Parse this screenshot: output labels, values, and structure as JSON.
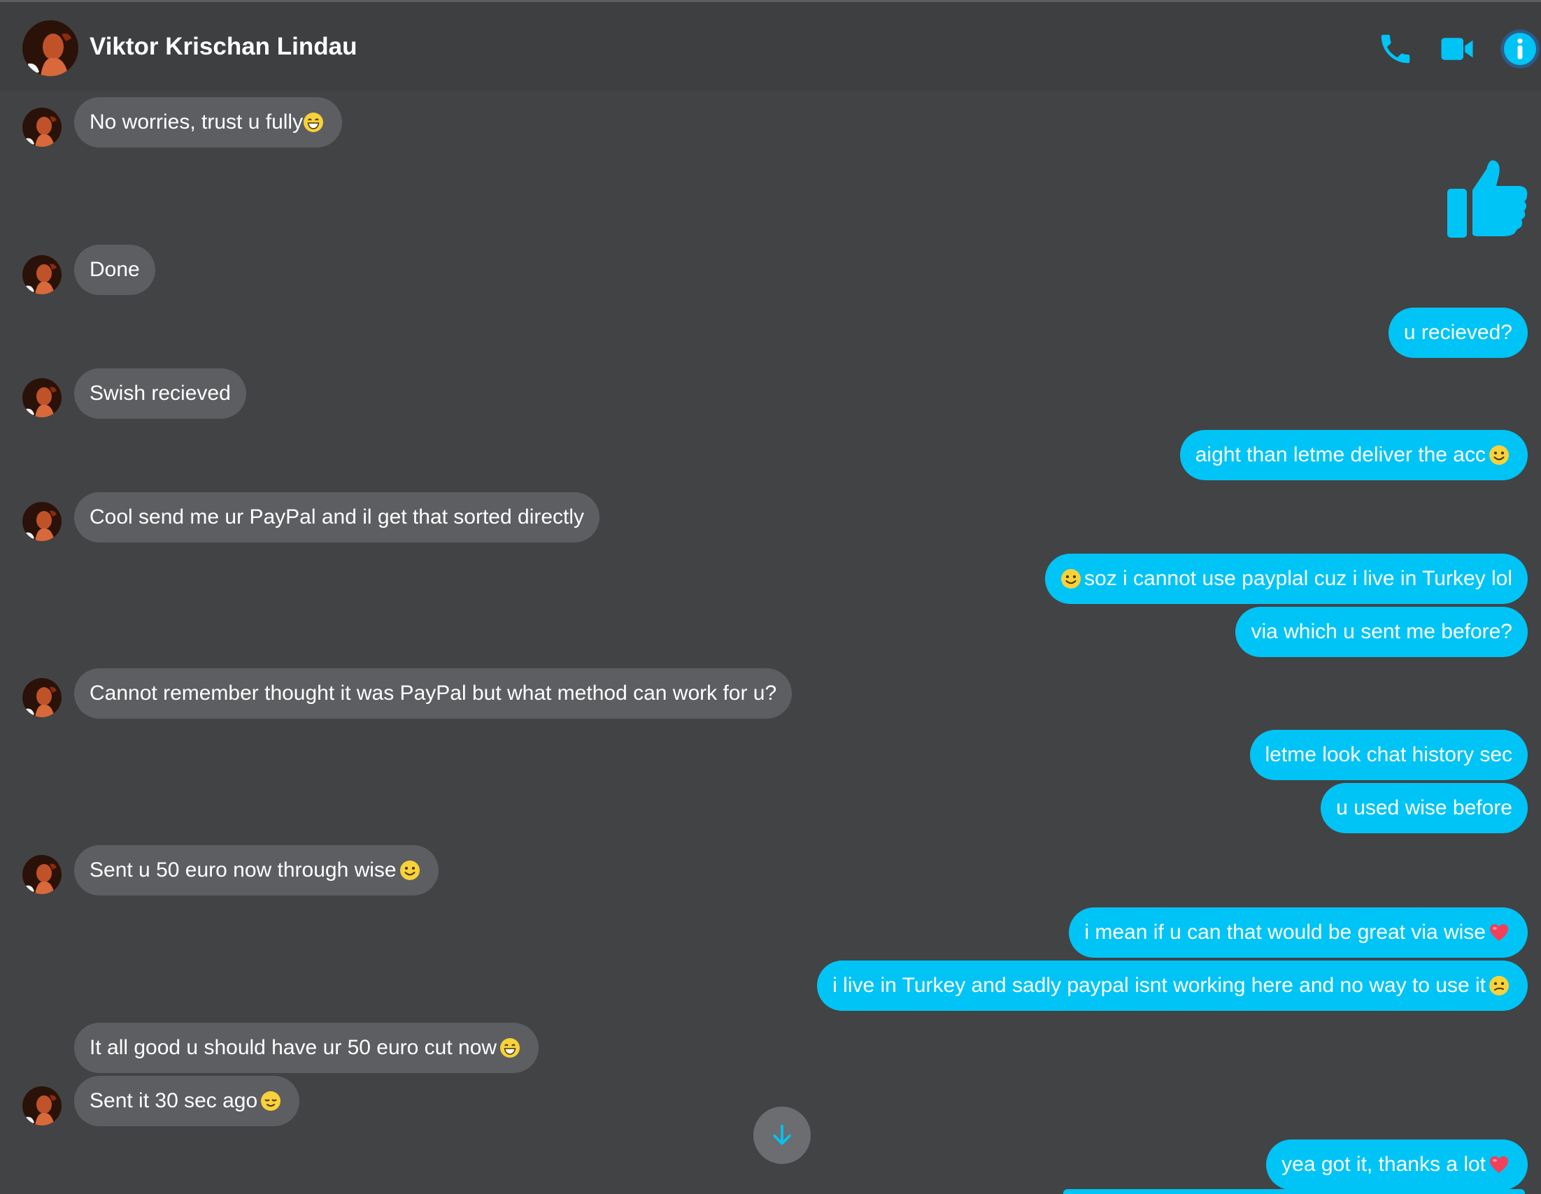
{
  "header": {
    "contact_name": "Viktor Krischan Lindau",
    "icons": [
      "phone-icon",
      "video-camera-icon",
      "info-icon"
    ]
  },
  "colors": {
    "background": "#424345",
    "incoming_bubble": "#5d5e61",
    "outgoing_bubble": "#00c4f5",
    "accent": "#00c4f5"
  },
  "messages": {
    "m1": "No worries,  trust u fully",
    "m2": "Done",
    "m3": "u recieved?",
    "m4": "Swish recieved",
    "m5": "aight than letme deliver the acc",
    "m6": "Cool send me ur PayPal and il get that sorted directly",
    "m7": "soz i cannot use payplal cuz i live in Turkey lol",
    "m8": "via which u sent me before?",
    "m9": "Cannot remember thought it was PayPal but what method can work for u?",
    "m10": "letme look chat history sec",
    "m11": "u used wise before",
    "m12": "Sent u 50 euro now through wise",
    "m13": "i mean if u can that would be great via wise",
    "m14": "i live in Turkey and sadly paypal isnt working here and no way to use it",
    "m15": "It all good u should have ur 50 euro cut now",
    "m16": "Sent it 30 sec ago",
    "m17": "yea got it, thanks a lot"
  },
  "reactions": {
    "thumbs_up": "thumbs-up-icon"
  },
  "scroll_button": "arrow-down-icon"
}
